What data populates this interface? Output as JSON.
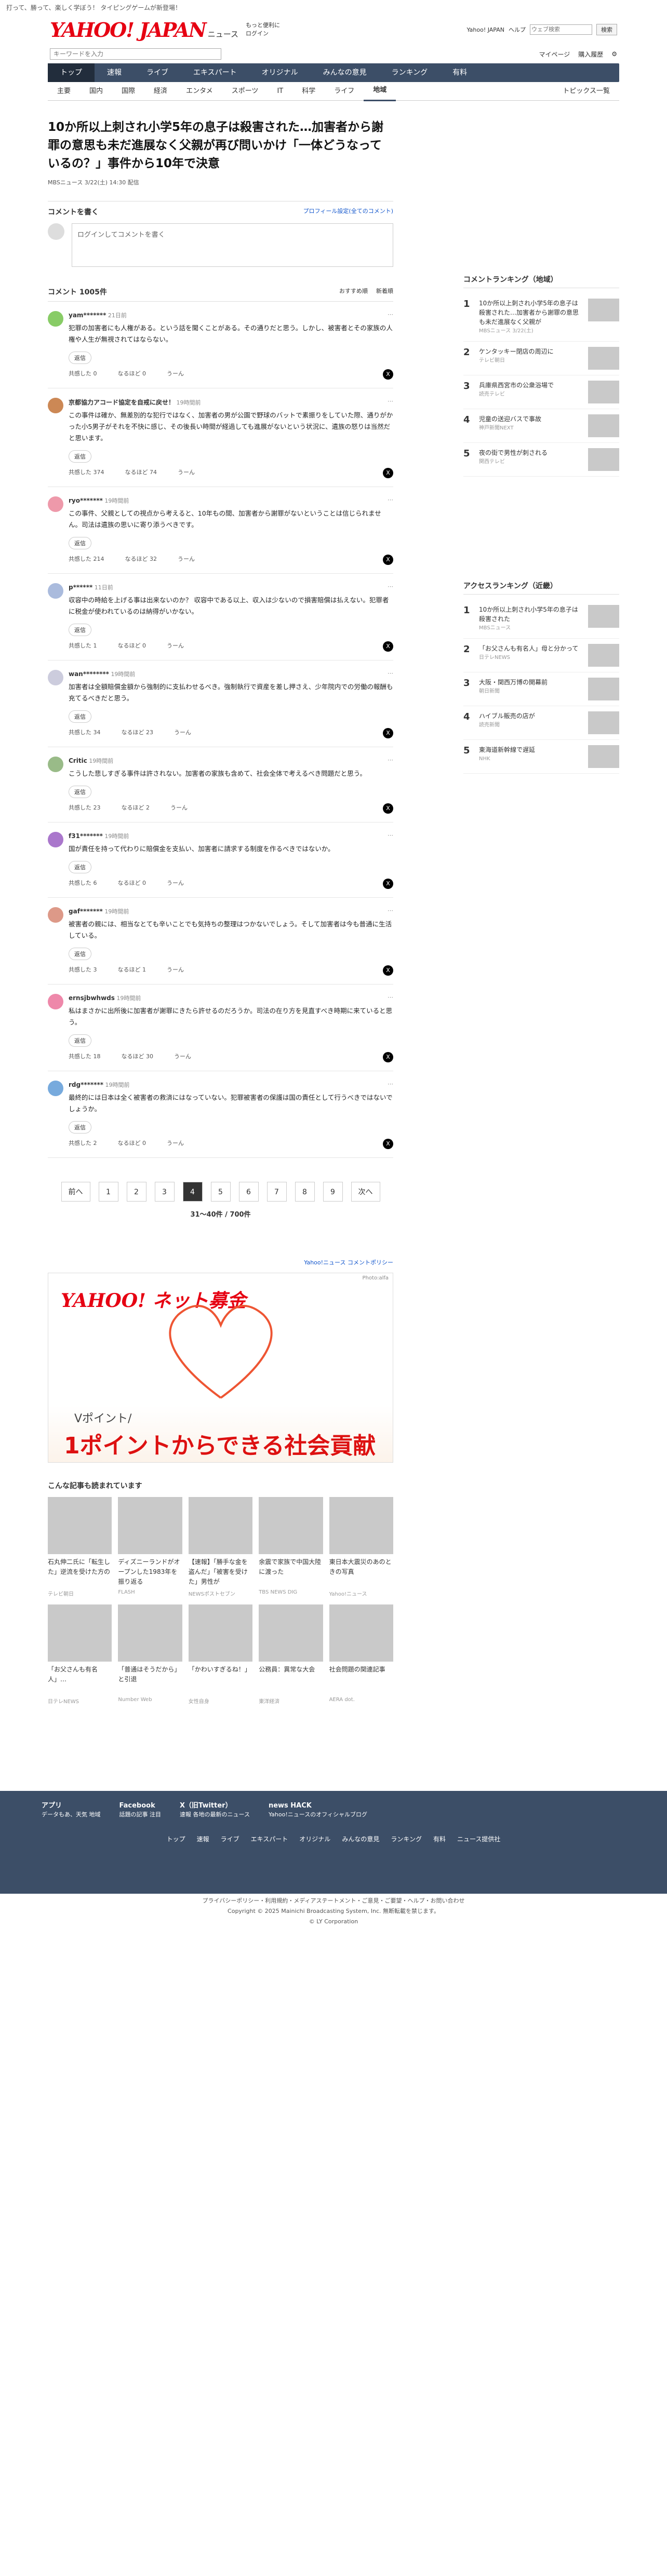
{
  "topbar": {
    "text": "打って、勝って、楽しく学ぼう！ タイピングゲームが新登場！"
  },
  "header": {
    "brand": "YAHOO! JAPAN",
    "service": "ニュース",
    "tag1": "ログイン",
    "tag2": "もっと便利に",
    "links": [
      "Yahoo! JAPAN",
      "ヘルプ"
    ],
    "search_placeholder": "ウェブ検索",
    "search_label": "検索"
  },
  "search": {
    "placeholder": "キーワードを入力",
    "links": [
      "マイページ",
      "購入履歴"
    ]
  },
  "global_nav": [
    "トップ",
    "速報",
    "ライブ",
    "エキスパート",
    "オリジナル",
    "みんなの意見",
    "ランキング",
    "有料"
  ],
  "sub_nav": [
    "主要",
    "国内",
    "国際",
    "経済",
    "エンタメ",
    "スポーツ",
    "IT",
    "科学",
    "ライフ",
    "地域"
  ],
  "sub_nav_right": "トピックス一覧",
  "article": {
    "title": "10か所以上刺され小学5年の息子は殺害された…加害者から謝罪の意思も未だ進展なく父親が再び問いかけ「一体どうなっているの？」事件から10年で決意",
    "source": "MBSニュース 3/22(土) 14:30 配信"
  },
  "comment_form": {
    "heading": "コメントを書く",
    "right": "プロフィール設定(全てのコメント)",
    "placeholder": "ログインしてコメントを書く"
  },
  "comment_list": {
    "heading": "コメント 1005件",
    "sort1": "おすすめ順",
    "sort2": "新着順"
  },
  "comments": [
    {
      "user": "yam*******",
      "time": "21日前",
      "text": "犯罪の加害者にも人権がある。という話を聞くことがある。その通りだと思う。しかし、被害者とその家族の人権や人生が無視されてはならない。",
      "up": "0",
      "down": "0"
    },
    {
      "user": "京都協力アコード協定を自戒に戻せ！",
      "time": "19時間前",
      "text": "この事件は確か、無差別的な犯行ではなく、加害者の男が公園で野球のバットで素振りをしていた際、通りがかった小5男子がそれを不快に感じ、その後長い時間が経過しても進展がないという状況に、遺族の怒りは当然だと思います。",
      "up": "374",
      "down": "74"
    },
    {
      "user": "ryo*******",
      "time": "19時間前",
      "text": "この事件、父親としての視点から考えると、10年もの間、加害者から謝罪がないということは信じられません。司法は遺族の思いに寄り添うべきです。",
      "up": "214",
      "down": "32"
    },
    {
      "user": "p******",
      "time": "11日前",
      "text": "収容中の時給を上げる事は出来ないのか？ 収容中である以上、収入は少ないので損害賠償は払えない。犯罪者に税金が使われているのは納得がいかない。",
      "up": "1",
      "down": "0"
    },
    {
      "user": "wan********",
      "time": "19時間前",
      "text": "加害者は全額賠償金額から強制的に支払わせるべき。強制執行で資産を差し押さえ、少年院内での労働の報酬も充てるべきだと思う。",
      "up": "34",
      "down": "23"
    },
    {
      "user": "Critic",
      "time": "19時間前",
      "text": "こうした悲しすぎる事件は許されない。加害者の家族も含めて、社会全体で考えるべき問題だと思う。",
      "up": "23",
      "down": "2"
    },
    {
      "user": "f31*******",
      "time": "19時間前",
      "text": "国が責任を持って代わりに賠償金を支払い、加害者に請求する制度を作るべきではないか。",
      "up": "6",
      "down": "0"
    },
    {
      "user": "gaf*******",
      "time": "19時間前",
      "text": "被害者の親には、相当なとても辛いことでも気持ちの整理はつかないでしょう。そして加害者は今も普通に生活している。",
      "up": "3",
      "down": "1"
    },
    {
      "user": "ernsjbwhwds",
      "time": "19時間前",
      "text": "私はまさかに出所後に加害者が謝罪にきたら許せるのだろうか。司法の在り方を見直すべき時期に来ていると思う。",
      "up": "18",
      "down": "30"
    },
    {
      "user": "rdg*******",
      "time": "19時間前",
      "text": "最終的には日本は全く被害者の救済にはなっていない。犯罪被害者の保護は国の責任として行うべきではないでしょうか。",
      "up": "2",
      "down": "0"
    }
  ],
  "labels": {
    "reply": "返信",
    "good": "共感した",
    "hmm": "なるほど",
    "bad": "うーん"
  },
  "pager": {
    "prev": "前へ",
    "pages": [
      "1",
      "2",
      "3",
      "4",
      "5",
      "6",
      "7",
      "8",
      "9"
    ],
    "current": "4",
    "next": "次へ",
    "count": "31〜40件 / 700件"
  },
  "footer_terms": "Yahoo!ニュース コメントポリシー",
  "banner": {
    "photo": "Photo:alfa",
    "brand": "YAHOO! ネット募金",
    "line1": "Vポイント/",
    "line2": "1ポイントからできる社会貢献"
  },
  "recommend": {
    "heading": "こんな記事も読まれています",
    "items": [
      {
        "title": "石丸伸二氏に「転生した」逆流を受けた方の",
        "src": "テレビ朝日"
      },
      {
        "title": "ディズニーランドがオープンした1983年を振り返る",
        "src": "FLASH"
      },
      {
        "title": "【速報】「勝手な金を盗んだ」「被害を受けた」男性が",
        "src": "NEWSポストセブン"
      },
      {
        "title": "余震で家族で中国大陸に渡った",
        "src": "TBS NEWS DIG"
      },
      {
        "title": "東日本大震災のあのときの写真",
        "src": "Yahoo!ニュース"
      },
      {
        "title": "「お父さんも有名人」…",
        "src": "日テレNEWS"
      },
      {
        "title": "「普通はそうだから」と引退",
        "src": "Number Web"
      },
      {
        "title": "「かわいすぎるね！」",
        "src": "女性自身"
      },
      {
        "title": "公務員：異常な大会",
        "src": "東洋経済"
      },
      {
        "title": "社会問題の関連記事",
        "src": "AERA dot."
      }
    ]
  },
  "ranking": {
    "heading": "コメントランキング（地域）",
    "items": [
      {
        "n": "1",
        "title": "10か所以上刺され小学5年の息子は殺害された…加害者から謝罪の意思も未だ進展なく父親が",
        "meta": "MBSニュース 3/22(土)"
      },
      {
        "n": "2",
        "title": "ケンタッキー閉店の周辺に",
        "meta": "テレビ朝日"
      },
      {
        "n": "3",
        "title": "兵庫県西宮市の公衆浴場で",
        "meta": "読売テレビ"
      },
      {
        "n": "4",
        "title": "児童の送迎バスで事故",
        "meta": "神戸新聞NEXT"
      },
      {
        "n": "5",
        "title": "夜の街で男性が刺される",
        "meta": "関西テレビ"
      }
    ]
  },
  "access": {
    "heading": "アクセスランキング（近畿）",
    "items": [
      {
        "n": "1",
        "title": "10か所以上刺され小学5年の息子は殺害された",
        "meta": "MBSニュース"
      },
      {
        "n": "2",
        "title": "「お父さんも有名人」母と分かって",
        "meta": "日テレNEWS"
      },
      {
        "n": "3",
        "title": "大阪・関西万博の開幕前",
        "meta": "朝日新聞"
      },
      {
        "n": "4",
        "title": "ハイブル販売の店が",
        "meta": "読売新聞"
      },
      {
        "n": "5",
        "title": "東海道新幹線で遅延",
        "meta": "NHK"
      }
    ]
  },
  "footer": {
    "apps": [
      {
        "name": "アプリ",
        "desc": "データもあ、天気 地域"
      },
      {
        "name": "Facebook",
        "desc": "話題の記事 注目"
      },
      {
        "name": "X（旧Twitter）",
        "desc": "速報 各地の最新のニュース"
      },
      {
        "name": "news HACK",
        "desc": "Yahoo!ニュースのオフィシャルブログ"
      }
    ],
    "links": [
      "トップ",
      "速報",
      "ライブ",
      "エキスパート",
      "オリジナル",
      "みんなの意見",
      "ランキング",
      "有料",
      "ニュース提供社"
    ],
    "bottom1": "プライバシーポリシー・利用規約・メディアステートメント・ご意見・ご要望・ヘルプ・お問い合わせ",
    "bottom2": "Copyright © 2025 Mainichi Broadcasting System, Inc. 無断転載を禁じます。",
    "bottom3": "© LY Corporation"
  }
}
